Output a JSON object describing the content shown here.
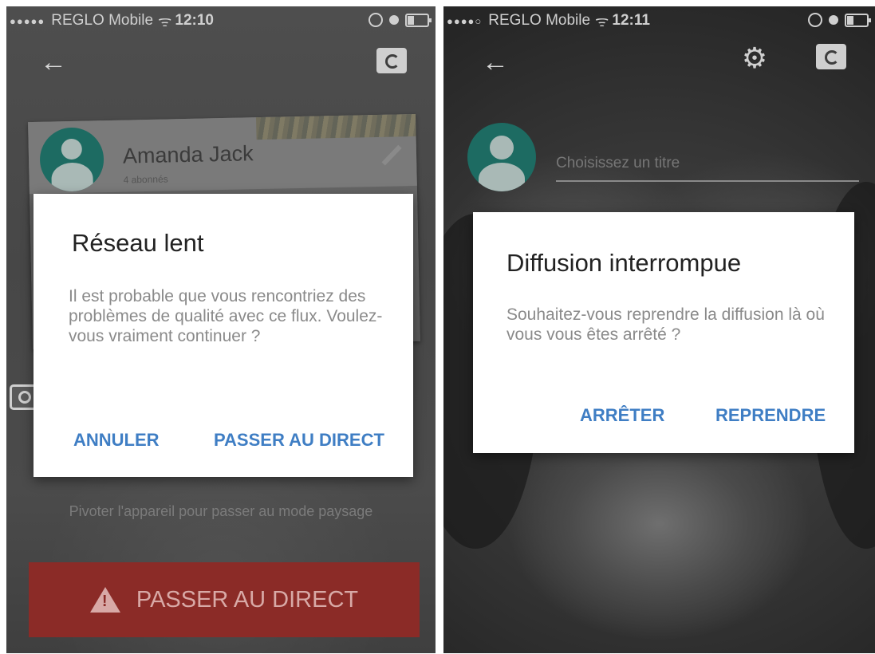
{
  "left": {
    "status": {
      "signal": "●●●●●",
      "carrier": "REGLO Mobile",
      "wifi": "ᯤ",
      "time": "12:10"
    },
    "profile": {
      "name": "Amanda Jack",
      "subscribers": "4 abonnés"
    },
    "rotate_hint": "Pivoter l'appareil pour passer au mode paysage",
    "live_button": "PASSER AU DIRECT",
    "dialog": {
      "title": "Réseau lent",
      "message": "Il est probable que vous rencontriez des problèmes de qualité avec ce flux. Voulez-vous vraiment continuer ?",
      "cancel": "ANNULER",
      "confirm": "PASSER AU DIRECT"
    }
  },
  "right": {
    "status": {
      "signal": "●●●●○",
      "carrier": "REGLO Mobile",
      "wifi": "ᯤ",
      "time": "12:11"
    },
    "title_placeholder": "Choisissez un titre",
    "dialog": {
      "title": "Diffusion interrompue",
      "message": "Souhaitez-vous reprendre la diffusion là où vous vous êtes arrêté ?",
      "stop": "ARRÊTER",
      "resume": "REPRENDRE"
    }
  },
  "colors": {
    "accent": "#3f7ec4",
    "live_button": "#8b2b27",
    "avatar": "#1d6b62"
  },
  "icons": [
    "back-arrow-icon",
    "camera-switch-icon",
    "gear-icon",
    "pencil-icon",
    "camera-icon",
    "warning-icon",
    "battery-icon",
    "alarm-icon",
    "rotation-lock-icon"
  ]
}
